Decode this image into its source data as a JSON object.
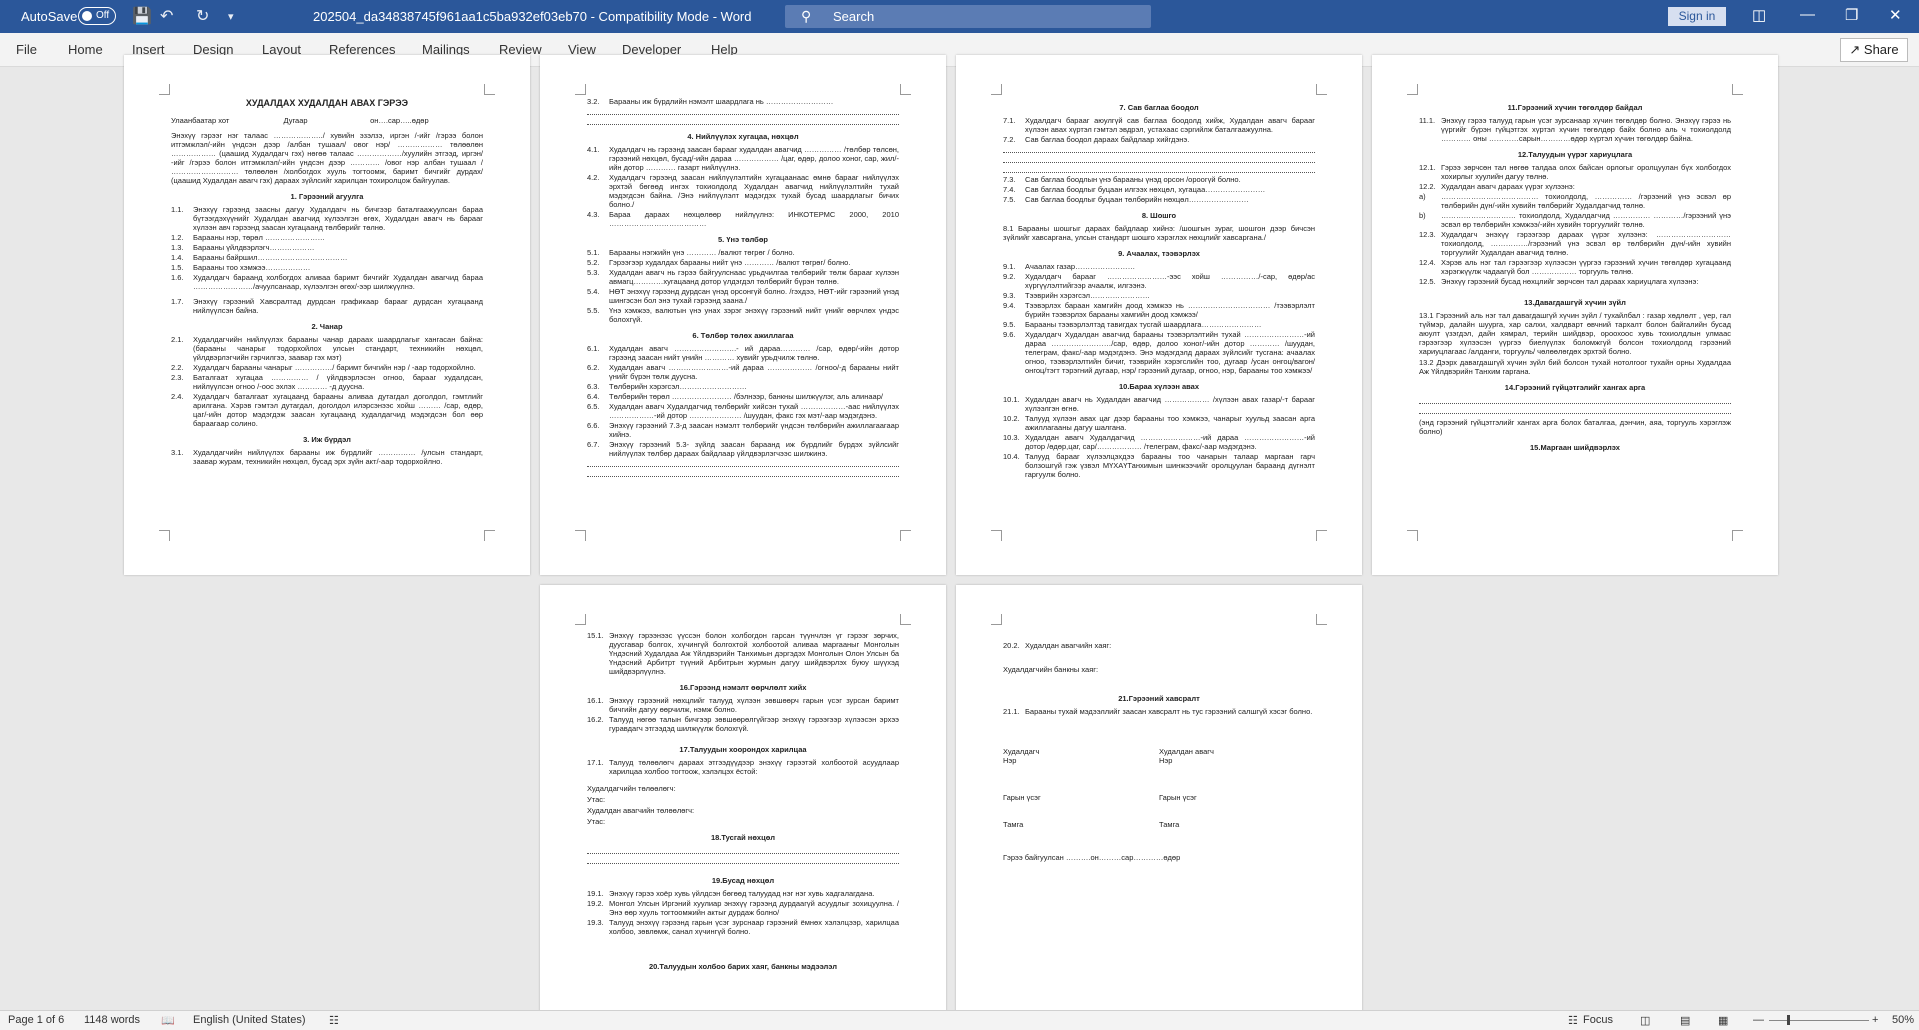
{
  "titlebar": {
    "autosave_label": "AutoSave",
    "autosave_state": "Off",
    "document_title": "202504_da34838745f961aa1c5ba932ef03eb70  -  Compatibility Mode  -  Word",
    "search_placeholder": "Search",
    "signin_label": "Sign in"
  },
  "ribbon": {
    "tabs": [
      "File",
      "Home",
      "Insert",
      "Design",
      "Layout",
      "References",
      "Mailings",
      "Review",
      "View",
      "Developer",
      "Help"
    ],
    "share_label": "Share"
  },
  "pages": {
    "p1": {
      "title": "ХУДАЛДАХ ХУДАЛДАН АВАХ ГЭРЭЭ",
      "header_line": "Улаанбаатар хот                          Дугаар                              он….сар…..өдөр",
      "intro": "Энэхүү гэрээг нэг талаас ………………../ хувийн эзэлзэ, иргэн /-ийг /гэрээ болон итгэмжлэл/-ийн үндсэн дээр /албан тушаал/ овог нэр/ ……………… төлөөлөн ……………… (цаашид Худалдагч гэх) нөгөө талаас ………………/хуулийн этгээд, иргэн/ -ийг /гэрээ болон итгэмжлэл/-ийн үндсэн дээр ………… /овог нэр албан тушаал / ……………………… төлөөлөн /холбогдох хууль тогтоомж, баримт бичгийг дурдах/ (цаашид Худалдан авагч гэх) дараах зүйлсийг харилцан тохиролцож байгуулав.",
      "s1": "1.  Гэрээний агуулга",
      "i1_1": "Энэхүү гэрээнд заасны дагуу Худалдагч нь бичгээр баталгаажуулсан бараа бүтээгдэхүүнийг Худалдан авагчид хүлээлгэн өгөх, Худалдан авагч нь барааг хүлээн авч гэрээнд заасан хугацаанд төлбөрийг төлнө.",
      "i1_2": "Барааны нэр, төрөл ……………………",
      "i1_3": "Барааны үйлдвэрлэгч………………",
      "i1_4": "Барааны байршил………………………………",
      "i1_5": "Барааны тоо хэмжээ………………",
      "i1_6": "Худалдагч бараанд холбогдох аливаа баримт бичгийг Худалдан авагчид бараа ……………………/ачуулсанаар, хүлээлгэн өгөх/-ээр шилжүүлнэ.",
      "i1_7": "Энэхүү гэрээний Хавсралтад дурдсан графикаар барааг дурдсан хугацаанд нийлүүлсэн байна.",
      "s2": "2.  Чанар",
      "i2_1": "Худалдагчийн нийлүүлэх барааны чанар дараах шаардлагыг хангасан байна: (барааны чанарыг тодорхойлох улсын стандарт, техникийн нөхцөл, үйлдвэрлэгчийн гэрчилгээ, заавар гэх мэт)",
      "i2_2": "Худалдагч барааны чанарыг ……………/ баримт бичгийн нэр / -аар тодорхойлно.",
      "i2_3": "Баталгаат хугацаа …………… / үйлдвэрлэсэн огноо, барааг худалдсан, нийлүүлсэн огноо /-оос эхлэх ………… -д дуусна.",
      "i2_4": "Худалдагч баталгаат хугацаанд барааны аливаа дутагдал доголдол, гэмтлийг арилгана. Хэрэв гэмтэл дутагдал, доголдол илэрсэнээс хойш ……… /сар, өдөр, цаг/-ийн дотор мэдэгдэж заасан хугацаанд худалдагчид мэдэгдсэн бол өөр бараагаар солино.",
      "s3": "3.  Иж бүрдэл",
      "i3_1": "Худалдагчийн нийлүүлэх барааны иж бүрдлийг …………… /улсын стандарт, заавар журам, техникийн нөхцөл, бусад эрх зүйн акт/-аар тодорхойлно."
    },
    "p2": {
      "i3_2": "Барааны иж бүрдлийн нэмэлт шаардлага нь ………………………",
      "s4": "4.  Нийлүүлэх хугацаа, нөхцөл",
      "i4_1": "Худалдагч нь гэрээнд заасан барааг худалдан авагчид …………… /төлбөр төлсөн, гэрээний нөхцөл, бусад/-ийн дараа ……………… /цаг, өдөр, долоо хоног, сар, жил/-ийн дотор ………… газарт нийлүүлнэ.",
      "i4_2": "Худалдагч гэрээнд заасан нийлүүлэлтийн хугацаанаас өмнө барааг нийлүүлэх эрхтэй бөгөөд ингэх тохиолдолд Худалдан авагчид нийлүүлэлтийн тухай мэдэгдсэн байна. /Энэ нийлүүлэлт мэдэгдэх тухай бусад шаардлагыг бичих болно./",
      "i4_3": "Бараа дараах нөхцөлөөр нийлүүлнэ: ИНКОТЕРМС 2000, 2010 …………………………………",
      "s5": "5.  Үнэ төлбөр",
      "i5_1": "Барааны нэгжийн үнэ ………… /валют төгрөг / болно.",
      "i5_2": "Гэрээгээр худалдах барааны нийт үнэ ………… /валют төгрөг/ болно.",
      "i5_3": "Худалдан авагч нь гэрээ байгуулснаас урьдчилгаа төлбөрийг төлж барааг хүлээн авмагц…………хугацаанд дотор үлдэгдэл төлбөрийг бүрэн төлнө.",
      "i5_4": "НӨТ энэхүү гэрээнд дурдсан үнэд орсонгүй болно. /гэхдээ, НӨТ-ийг гэрээний үнэд шингэсэн бол энэ тухай гэрээнд заана./",
      "i5_5": "Үнэ хэмжээ, валютын үнэ унах зэрэг энэхүү гэрээний нийт үнийг өөрчлөх үндэс болохгүй.",
      "s6": "6.  Төлбөр төлөх ажиллагаа",
      "i6_1": "Худалдан авагч …………………….- ий дараа………… /сар, өдөр/-ийн дотор гэрээнд заасан нийт үнийн ………… хувийг урьдчилж төлнө.",
      "i6_2": "Худалдан авагч ……………………-ий дараа ……………… /огноо/-д барааны нийт үнийг бүрэн төлж дууснa.",
      "i6_3": "Төлбөрийн хэрэгсэл………………………",
      "i6_4": "Төлбөрийн төрөл …………………… /бэлнээр, банкны шилжүүлэг, аль алинаар/",
      "i6_5": "Худалдан авагч Худалдагчид төлбөрийг хийсэн тухай ………………-аас нийлүүлэх ………………-ий дотор ………………… /шуудан, факс гэх мэт/-аар мэдэгдэнэ.",
      "i6_6": "Энэхүү гэрээний 7.3-д заасан нэмэлт төлбөрийг үндсэн төлбөрийн ажиллагаагаар хийнэ.",
      "i6_7": "Энэхүү гэрээний 5.3- зүйлд заасан бараанд иж бүрдлийг бүрдэх зүйлсийг нийлүүлэх төлбөр дараах байдлаар үйлдвэрлэгчээс шилжинэ."
    },
    "p3": {
      "s7": "7.  Сав баглаа боодол",
      "i7_1": "Худалдагч барааг аюулгүй сав баглаа боодолд хийж, Худалдан авагч барааг хүлээн авах хүртэл гэмтэл эвдрэл, устахаас сэргийлж баталгаажуулна.",
      "i7_2": "Сав баглаа боодол дараах байдлаар хийгдэнэ.",
      "i7_3": "Сав баглаа боодлын үнэ барааны үнэд орсон /ороогүй болно.",
      "i7_4": "Сав баглаа боодлыг буцаан илгээх нөхцөл, хугацаа……………………",
      "i7_5": "Сав баглаа боодлыг буцаан төлбөрийн нөхцөл……………………",
      "s8": "8.  Шошго",
      "p8_1": "8.1 Барааны шошгыг дараах байдлаар хийнэ: /шошгын зураг, шошгон дээр бичсэн зүйлийг хавсаргана, улсын стандарт шошго хэрэглэх нөхцлийг хавсаргана./",
      "s9": "9.  Ачаалах, тээвэрлэх",
      "i9_1": "Ачаалах газар……………………",
      "i9_2": "Худалдагч барааг ……………………-ээс хойш ……………/-сар, өдөр/ас хүргүүлэлтийгээр ачаалж, илгээнэ.",
      "i9_3": "Тээврийн хэрэгсэл……………………",
      "i9_4": "Тээвэрлэх бараан хамгийн доод хэмжээ нь …………………………… /тээвэрлэлт бүрийн тээвэрлэх барааны хамгийн доод хэмжээ/",
      "i9_5": "Барааны тээвэрлэлтэд тавигдах тусгай шаардлага……………………",
      "i9_6": "Худалдагч Худалдан авагчид барааны тээвэрлэлтийн тухай ……………………-ий дараа ……………………/сар, өдөр, долоо хоног/-ийн дотор ………… /шуудан, телеграм, факс/-аар мэдэгдэнэ. Энэ мэдэгдэлд дараах зүйлсийг тусгана: ачаалах огноо, тээвэрлэлтийн бичиг, тээврийн хэрэгслийн тоо, дугаар /усан онгоц/вагон/онгоц/тэгт тэрэгний дугаар, нэр/ гэрээний дугаар, огноо, нэр, барааны тоо хэмжээ/",
      "s10": "10.Бараа хүлээн авах",
      "i10_1": "Худалдан авагч нь Худалдан авагчид ……………… /хүлээн авах газар/-т барааг хүлээлгэн өгнө.",
      "i10_2": "Талууд хүлээн авах цаг дээр барааны тоо хэмжээ, чанарыг хуульд заасан арга ажиллагааны дагуу шалгана.",
      "i10_3": "Худалдан авагч Худалдагчид ……………………-ий дараа ……………………-ий дотор /өдөр,цаг, сар/……………… /телеграм, факс/-аар мэдэгдэнэ.",
      "i10_4": "Талууд барааг хүлээлцэхдээ барааны тоо чанарын талаар маргаан гарч болзошгүй гэж үзвэл МҮХАҮТанхимын шинжээчийг оролцуулан бараанд дүгнэлт гаргуулж болно."
    },
    "p4": {
      "s11": "11.Гэрээний хүчин төгөлдөр байдал",
      "i11_1": "Энэхүү гэрээ талууд гарын үсэг зурсанаар хүчин төгөлдөр болно. Энэхүү гэрээ нь үүргийг бүрэн гүйцэтгэх хүртэл хүчин төгөлдөр байх болно аль ч тохиолдолд ………… оны …………сарын…………өдөр хүртэл хүчин төгөлдөр байна.",
      "s12": "12.Талуудын үүрэг хариуцлага",
      "i12_1": "Гэрээ зөрчсөн тал нөгөө талдаа олох байсан орлогыг оролцуулан бүх холбогдох хохирлыг хуулийн дагуу төлнө.",
      "i12_2": "Худалдан авагч дараах үүрэг хүлээнэ:",
      "i12_a": "………………………………… тохиолдолд, …………… /гэрээний үнэ эсвэл өр төлбөрийн дүн/-ийн хувийн төлбөрийг Худалдагчид төлнө.",
      "i12_b": "………………………… тохиолдолд, Худалдагчид …………… …………/гэрээний үнэ эсвэл өр төлбөрийн хэмжээ/-ийн хувийн торгуулийг төлнө.",
      "i12_3": "Худалдагч энэхүү гэрээгээр дараах үүрэг хүлээнэ: ………………………… тохиолдолд, ……………/гэрээний үнэ эсвэл өр төлбөрийн дүн/-ийн хувийн торгуулийг Худалдан авагчид төлнө.",
      "i12_4": "Хэрэв аль нэг тал гэрээгээр хүлээсэн үүргээ гэрээний хүчин төгөлдөр хугацаанд хэрэгжүүлж чадаагүй бол ……………… торгууль төлнө.",
      "i12_5": "Энэхүү гэрээний бусад нөхцлийг зөрчсөн тал дараах хариуцлага хүлээнэ:",
      "s13": "13.Давагдашгүй хүчин зүйл",
      "p13_1": "13.1 Гэрээний аль нэг тал давагдашгүй хүчин зүйл / тухайлбал : газар хөдлөлт , үер, гал түймэр, далайн шуурга, хар салхи, халдварт өвчний тархалт болон байгалийн бусад аюулт үзэгдэл, дайн хямрал, терийн шийдвэр, ороохоос хувь тохиолдлын улмаас гэрээгээр хүлээсэн үүргээ биелүүлэх боломжгүй болсон тохиолдолд гэрээний хариуцлагаас /алданги, торгууль/ чөлөөлөгдөх эрхтэй болно.",
      "p13_2": "13.2 Дээрх давагдашгүй хүчин зүйл бий болсон тухай нотолгоог тухайн орны Худалдаа Аж Үйлдвэрийн Танхим гаргана.",
      "s14": "14.Гэрээний гүйцэтгэлийг хангах арга",
      "p14_1": "(энд гэрээний гүйцэтгэлийг хангах арга болох баталгаа, дэнчин, аяа, торгууль хэрэглэж болно)",
      "s15": "15.Маргаан шийдвэрлэх"
    },
    "p5": {
      "i15_1": "Энэхүү гэрээнээс үүссэн болон холбогдон гарсан түүнчлэн үг гэрээг зөрчих, дуусгавар болгох, хүчингүй болгохтой холбоотой аливаа маргааныг Монголын Үндэсний Худалдаа Аж Үйлдвэрийн Танхимын дэргэдэх Монголын Олон Улсын ба Үндэсний Арбитрт түүний Арбитрын журмын дагуу шийдвэрлэх буюу шүүхэд шийдвэрлүүлнэ.",
      "s16": "16.Гэрээнд нэмэлт өөрчлөлт хийх",
      "i16_1": "Энэхүү гэрээний нөхцлийг талууд хүлээн зөвшөөрч гарын үсэг зурсан баримт бичгийн дагуу өөрчилж, нэмж болно.",
      "i16_2": "Талууд нөгөө талын бичгээр зөвшөөрөлгүйгээр энэхүү гэрээгээр хүлээсэн эрхээ гуравдагч этгээдэд шилжүүлж болохгүй.",
      "s17": "17.Талуудын хоорондох харилцаа",
      "i17_1": "Талууд төлөөлөгч дараах этгээдүүдээр энэхүү гэрээтэй холбоотой асуудлаар харилцаа холбоо тогтоож, хэлэлцэх ёстой:",
      "rep_seller": "Худалдагчийн төлөөлөгч:",
      "phone1": "Утас:",
      "rep_buyer": "Худалдан авагчийн төлөөлөгч:",
      "phone2": "Утас:",
      "s18": "18.Тусгай нөхцөл",
      "s19": "19.Бусад нөхцөл",
      "i19_1": "Энэхүү гэрээ хоёр хувь үйлдсэн бөгөөд талуудад нэг нэг хувь хадгалагдана.",
      "i19_2": "Монгол Улсын Иргэний хуулиар энэхүү гэрээнд дурдаагүй асуудлыг зохицуулна. /Энэ өөр хууль тогтоомжийн актыг дурдаж болно/",
      "i19_3": "Талууд энэхүү гэрээнд гарын үсэг зурснаар гэрээний ёмнөх хэлэлцээр, харилцаа холбоо, зөвлөмж, санал хүчингүй болно.",
      "s20": "20.Талуудын холбоо барих хаяг, банкны мэдээлэл"
    },
    "p6": {
      "i20_2": "Худалдан авагчийн хаяг:",
      "bank": "Худалдагчийн банкны хаяг:",
      "s21": "21.Гэрээний хавсралт",
      "i21_1": "Барааны тухай мэдээллийг заасан хавсралт нь тус гэрээний салшгүй хэсэг болно.",
      "seller": "Худалдагч",
      "buyer": "Худалдан авагч",
      "name1": "Нэр",
      "name2": "Нэр",
      "sign1": "Гарын үсэг",
      "sign2": "Гарын үсэг",
      "stamp1": "Тамга",
      "stamp2": "Тамга",
      "date_line": "Гэрээ байгуулсан ……….он………сар…………өдөр"
    }
  },
  "statusbar": {
    "page_info": "Page 1 of 6",
    "word_count": "1148 words",
    "language": "English (United States)",
    "focus_label": "Focus",
    "zoom": "50%"
  }
}
